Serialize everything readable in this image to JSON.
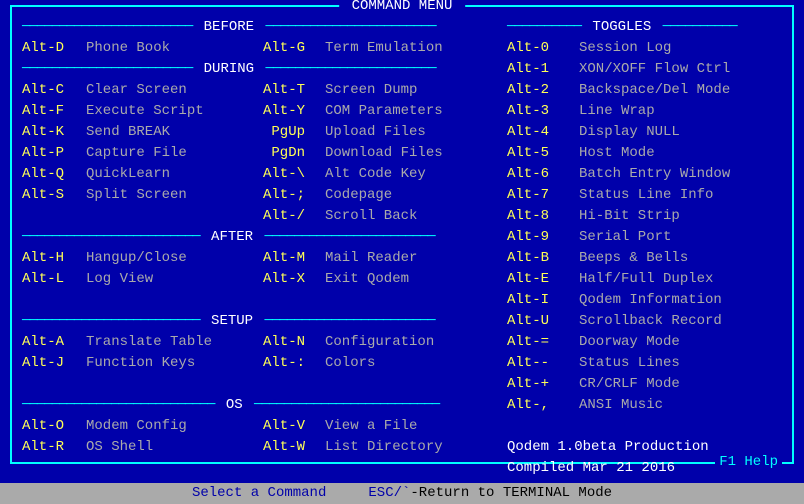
{
  "title": " COMMAND MENU ",
  "help": "F1 Help",
  "status": {
    "prompt": "Select a Command",
    "esc": "ESC/`",
    "ret": "-Return to TERMINAL Mode"
  },
  "sections": {
    "before": "BEFORE",
    "during": "DURING",
    "after": "AFTER",
    "setup": "SETUP",
    "os": "OS",
    "toggles": "TOGGLES"
  },
  "left": {
    "before": [
      {
        "k1": "Alt-D",
        "d1": "Phone Book",
        "k2": "Alt-G",
        "d2": "Term Emulation"
      }
    ],
    "during": [
      {
        "k1": "Alt-C",
        "d1": "Clear Screen",
        "k2": "Alt-T",
        "d2": "Screen Dump"
      },
      {
        "k1": "Alt-F",
        "d1": "Execute Script",
        "k2": "Alt-Y",
        "d2": "COM Parameters"
      },
      {
        "k1": "Alt-K",
        "d1": "Send BREAK",
        "k2": "PgUp",
        "d2": "Upload Files"
      },
      {
        "k1": "Alt-P",
        "d1": "Capture File",
        "k2": "PgDn",
        "d2": "Download Files"
      },
      {
        "k1": "Alt-Q",
        "d1": "QuickLearn",
        "k2": "Alt-\\",
        "d2": "Alt Code Key"
      },
      {
        "k1": "Alt-S",
        "d1": "Split Screen",
        "k2": "Alt-;",
        "d2": "Codepage"
      },
      {
        "k1": "",
        "d1": "",
        "k2": "Alt-/",
        "d2": "Scroll Back"
      }
    ],
    "after": [
      {
        "k1": "Alt-H",
        "d1": "Hangup/Close",
        "k2": "Alt-M",
        "d2": "Mail Reader"
      },
      {
        "k1": "Alt-L",
        "d1": "Log View",
        "k2": "Alt-X",
        "d2": "Exit Qodem"
      }
    ],
    "setup": [
      {
        "k1": "Alt-A",
        "d1": "Translate Table",
        "k2": "Alt-N",
        "d2": "Configuration"
      },
      {
        "k1": "Alt-J",
        "d1": "Function Keys",
        "k2": "Alt-:",
        "d2": "Colors"
      }
    ],
    "os": [
      {
        "k1": "Alt-O",
        "d1": "Modem Config",
        "k2": "Alt-V",
        "d2": "View a File"
      },
      {
        "k1": "Alt-R",
        "d1": "OS Shell",
        "k2": "Alt-W",
        "d2": "List Directory"
      }
    ]
  },
  "toggles": [
    {
      "k": "Alt-0",
      "d": "Session Log"
    },
    {
      "k": "Alt-1",
      "d": "XON/XOFF Flow Ctrl"
    },
    {
      "k": "Alt-2",
      "d": "Backspace/Del Mode"
    },
    {
      "k": "Alt-3",
      "d": "Line Wrap"
    },
    {
      "k": "Alt-4",
      "d": "Display NULL"
    },
    {
      "k": "Alt-5",
      "d": "Host Mode"
    },
    {
      "k": "Alt-6",
      "d": "Batch Entry Window"
    },
    {
      "k": "Alt-7",
      "d": "Status Line Info"
    },
    {
      "k": "Alt-8",
      "d": "Hi-Bit Strip"
    },
    {
      "k": "Alt-9",
      "d": "Serial Port"
    },
    {
      "k": "Alt-B",
      "d": "Beeps & Bells"
    },
    {
      "k": "Alt-E",
      "d": "Half/Full Duplex"
    },
    {
      "k": "Alt-I",
      "d": "Qodem Information"
    },
    {
      "k": "Alt-U",
      "d": "Scrollback Record"
    },
    {
      "k": "Alt-=",
      "d": "Doorway Mode"
    },
    {
      "k": "Alt--",
      "d": "Status Lines"
    },
    {
      "k": "Alt-+",
      "d": "CR/CRLF Mode"
    },
    {
      "k": "Alt-,",
      "d": "ANSI Music"
    }
  ],
  "version1": "Qodem 1.0beta Production",
  "version2": "Compiled Mar 21 2016"
}
